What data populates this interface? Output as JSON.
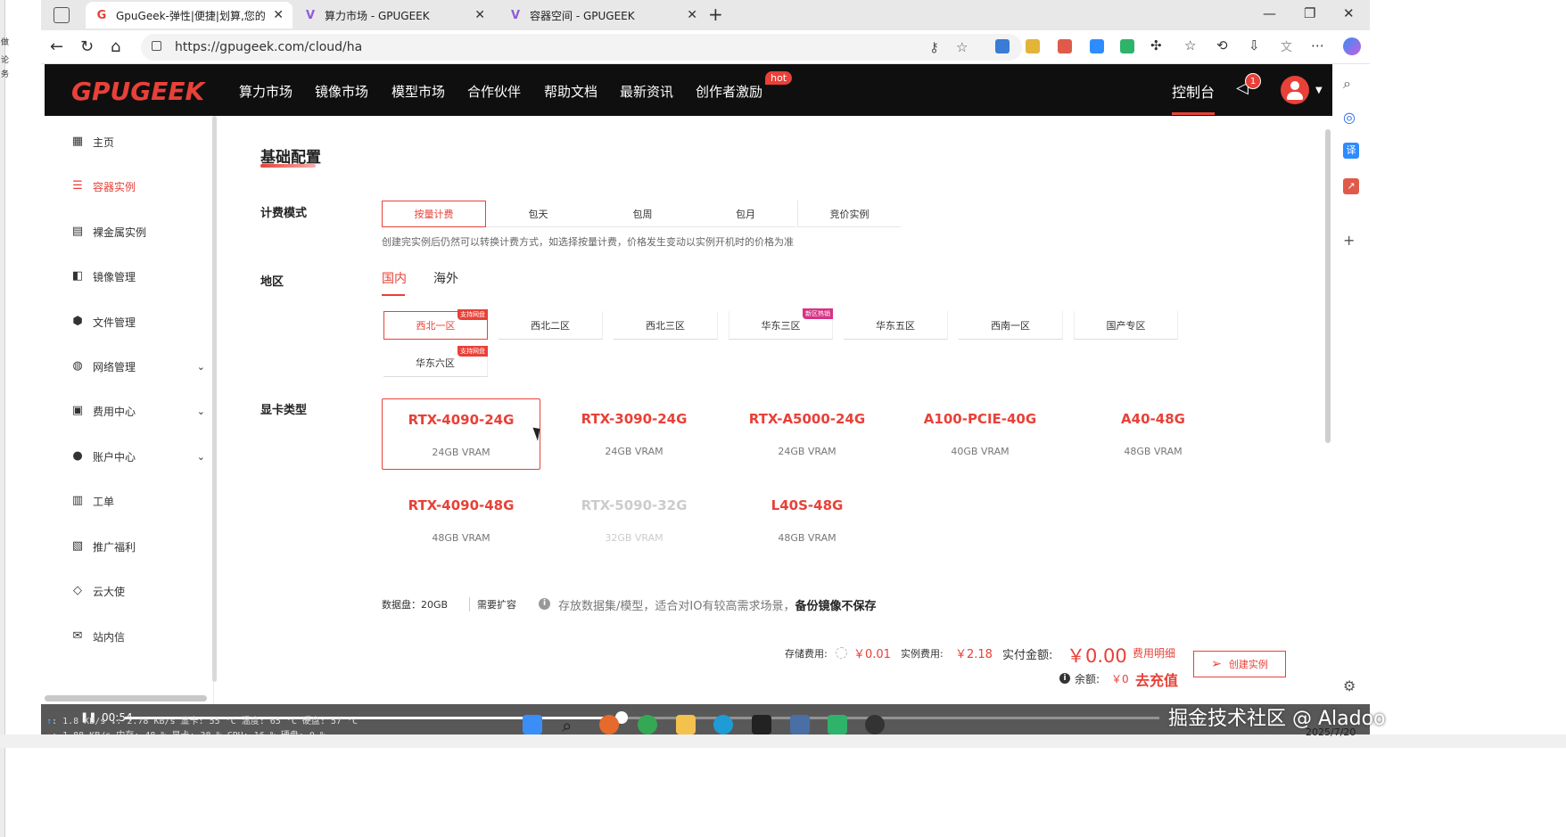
{
  "browser": {
    "tabs": [
      {
        "title": "GpuGeek-弹性|便捷|划算,您的专属",
        "active": true,
        "favicon": "G"
      },
      {
        "title": "算力市场 - GPUGEEK",
        "active": false,
        "favicon": "V"
      },
      {
        "title": "容器空间 - GPUGEEK",
        "active": false,
        "favicon": "V"
      }
    ],
    "url": "https://gpugeek.com/cloud/ha"
  },
  "strip_text": [
    "做",
    "论",
    "务"
  ],
  "site": {
    "logo": "GPUGEEK",
    "nav": [
      "算力市场",
      "镜像市场",
      "模型市场",
      "合作伙伴",
      "帮助文档",
      "最新资讯",
      "创作者激励"
    ],
    "hot_badge": "hot",
    "console": "控制台",
    "notify_count": "1",
    "accent": "#e84138"
  },
  "sidebar": [
    {
      "label": "主页",
      "icon": "grid-icon",
      "glyph": "▦"
    },
    {
      "label": "容器实例",
      "icon": "list-icon",
      "glyph": "☰",
      "active": true
    },
    {
      "label": "裸金属实例",
      "icon": "server-icon",
      "glyph": "▤"
    },
    {
      "label": "镜像管理",
      "icon": "image-icon",
      "glyph": "◧"
    },
    {
      "label": "文件管理",
      "icon": "file-icon",
      "glyph": "⬢"
    },
    {
      "label": "网络管理",
      "icon": "network-icon",
      "glyph": "◍",
      "expand": true
    },
    {
      "label": "费用中心",
      "icon": "wallet-icon",
      "glyph": "▣",
      "expand": true
    },
    {
      "label": "账户中心",
      "icon": "user-icon",
      "glyph": "●",
      "expand": true
    },
    {
      "label": "工单",
      "icon": "clipboard-icon",
      "glyph": "▥"
    },
    {
      "label": "推广福利",
      "icon": "gift-icon",
      "glyph": "▧"
    },
    {
      "label": "云大使",
      "icon": "diamond-icon",
      "glyph": "◇"
    },
    {
      "label": "站内信",
      "icon": "mail-icon",
      "glyph": "✉"
    }
  ],
  "config": {
    "title": "基础配置",
    "billing_label": "计费模式",
    "billing_modes": [
      "按量计费",
      "包天",
      "包周",
      "包月",
      "竞价实例"
    ],
    "billing_hint": "创建完实例后仍然可以转换计费方式，如选择按量计费，价格发生变动以实例开机时的价格为准",
    "region_label": "地区",
    "region_tabs": [
      "国内",
      "海外"
    ],
    "regions": [
      {
        "name": "西北一区",
        "badge": "支持网盘",
        "selected": true
      },
      {
        "name": "西北二区"
      },
      {
        "name": "西北三区"
      },
      {
        "name": "华东三区",
        "badge": "新区热销"
      },
      {
        "name": "华东五区"
      },
      {
        "name": "西南一区"
      },
      {
        "name": "国产专区"
      },
      {
        "name": "华东六区",
        "badge": "支持网盘"
      }
    ],
    "gpu_label": "显卡类型",
    "gpus": [
      {
        "name": "RTX-4090-24G",
        "vram": "24GB VRAM",
        "selected": true
      },
      {
        "name": "RTX-3090-24G",
        "vram": "24GB VRAM"
      },
      {
        "name": "RTX-A5000-24G",
        "vram": "24GB VRAM"
      },
      {
        "name": "A100-PCIE-40G",
        "vram": "40GB VRAM"
      },
      {
        "name": "A40-48G",
        "vram": "48GB VRAM"
      },
      {
        "name": "RTX-4090-48G",
        "vram": "48GB VRAM"
      },
      {
        "name": "RTX-5090-32G",
        "vram": "32GB VRAM",
        "disabled": true
      },
      {
        "name": "L40S-48G",
        "vram": "48GB VRAM"
      }
    ],
    "disk": {
      "label": "数据盘：20GB",
      "expand": "需要扩容",
      "hint": "存放数据集/模型，适合对IO有较高需求场景，",
      "hint_bold": "备份镜像不保存"
    }
  },
  "footer": {
    "storage_label": "存储费用:",
    "storage_value": "￥0.01",
    "instance_label": "实例费用:",
    "instance_value": "￥2.18",
    "pay_label": "实付金额:",
    "pay_value": "￥0.00",
    "fee_detail": "费用明细",
    "create_button": "创建实例",
    "balance_label": "余额:",
    "balance_value": "￥0",
    "recharge": "去充值"
  },
  "video": {
    "time": "00:54",
    "progress": 0.48
  },
  "overlay": {
    "net_up": "1.8",
    "net_up_rest": "KB/s ↓: 2.78 KB/s  显卡: 55 °C 温度: 65 °C 硬盘: 57 °C",
    "net_down": "1.88 KB/s",
    "net_down_rest": "内存: 48 %   显卡: 38 %  CPU: 16 %  硬盘: 0 %",
    "watermark": "掘金技术社区 @ Aladoo",
    "date": "2025/7/20"
  }
}
